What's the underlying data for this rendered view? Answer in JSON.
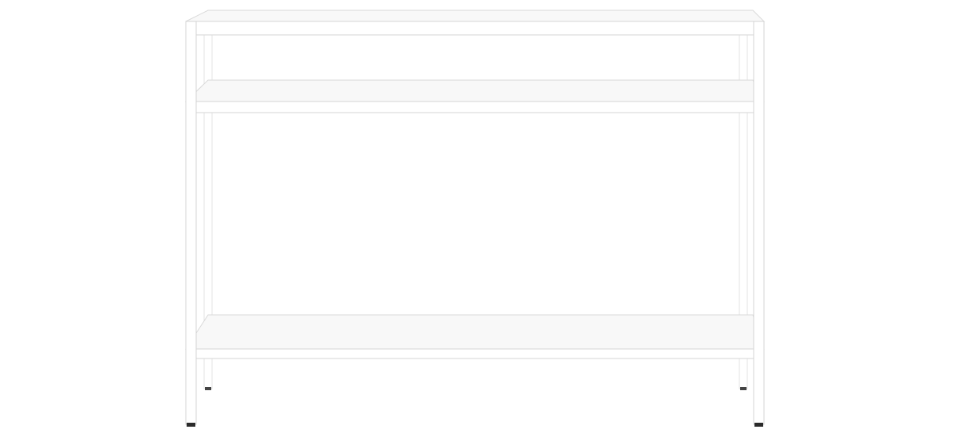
{
  "product": {
    "name": "console-table",
    "shelf_count": 3,
    "colors": {
      "background": "#ffffff",
      "frame": "#ffffff",
      "frame_edge": "#dcdcdc",
      "shelf_top": "#f7f7f7",
      "shelf_edge": "#d6d6d6",
      "foot": "#2b2b2b"
    }
  }
}
